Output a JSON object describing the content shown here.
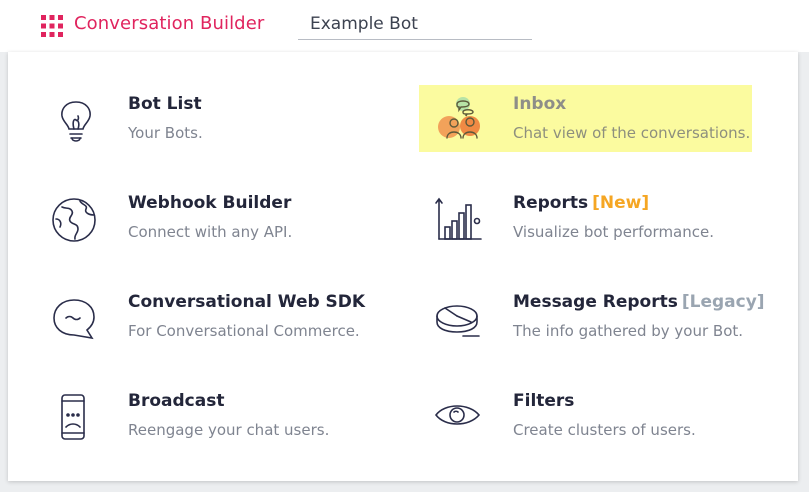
{
  "header": {
    "app_title": "Conversation Builder",
    "bot_name_value": "Example Bot",
    "brand_color": "#e0245e"
  },
  "menu": {
    "bot_list": {
      "title": "Bot List",
      "desc": "Your Bots.",
      "icon": "lightbulb-icon"
    },
    "inbox": {
      "title": "Inbox",
      "desc": "Chat view of the conversations.",
      "icon": "users-chat-icon",
      "highlighted": true
    },
    "webhook": {
      "title": "Webhook Builder",
      "desc": "Connect with any API.",
      "icon": "globe-icon"
    },
    "reports": {
      "title": "Reports",
      "badge": "[New]",
      "desc": "Visualize bot performance.",
      "icon": "bar-chart-icon"
    },
    "web_sdk": {
      "title": "Conversational Web SDK",
      "desc": "For Conversational Commerce.",
      "icon": "chat-bubble-icon"
    },
    "message_reports": {
      "title": "Message Reports",
      "badge": "[Legacy]",
      "desc": "The info gathered by your Bot.",
      "icon": "pie-chart-icon"
    },
    "broadcast": {
      "title": "Broadcast",
      "desc": "Reengage your chat users.",
      "icon": "phone-icon"
    },
    "filters": {
      "title": "Filters",
      "desc": "Create clusters of users.",
      "icon": "eye-icon"
    }
  },
  "colors": {
    "highlight": "#fbfb9f",
    "badge_new": "#f5a623",
    "badge_legacy": "#9aa5b1"
  }
}
